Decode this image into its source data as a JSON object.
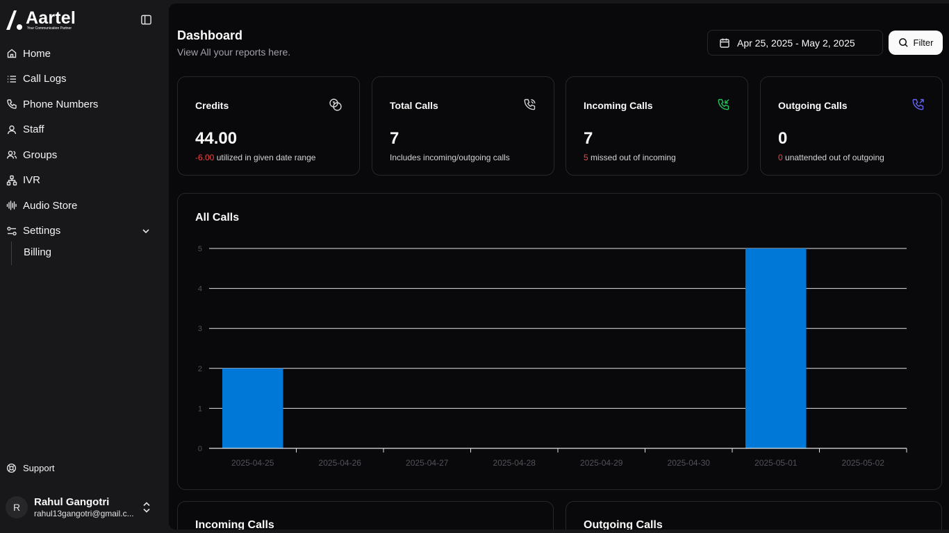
{
  "brand": {
    "name": "Aartel",
    "tagline": "Your Communication Partner"
  },
  "sidebar": {
    "items": [
      {
        "label": "Home",
        "icon": "home-icon"
      },
      {
        "label": "Call Logs",
        "icon": "list-icon"
      },
      {
        "label": "Phone Numbers",
        "icon": "phone-icon"
      },
      {
        "label": "Staff",
        "icon": "user-icon"
      },
      {
        "label": "Groups",
        "icon": "users-icon"
      },
      {
        "label": "IVR",
        "icon": "network-icon"
      },
      {
        "label": "Audio Store",
        "icon": "audio-wave-icon"
      },
      {
        "label": "Settings",
        "icon": "settings-sliders-icon"
      }
    ],
    "sub_items": [
      {
        "label": "Billing"
      }
    ],
    "support": "Support",
    "user": {
      "initial": "R",
      "name": "Rahul Gangotri",
      "email": "rahul13gangotri@gmail.c..."
    }
  },
  "header": {
    "title": "Dashboard",
    "subtitle": "View All your reports here.",
    "date_range": "Apr 25, 2025 - May 2, 2025",
    "filter_label": "Filter"
  },
  "cards": [
    {
      "title": "Credits",
      "value": "44.00",
      "note_highlight": "-6.00",
      "note": " utilized in given date range",
      "icon": "coins-icon",
      "icon_color": "#d4d4d8"
    },
    {
      "title": "Total Calls",
      "value": "7",
      "note_highlight": "",
      "note": "Includes incoming/outgoing calls",
      "icon": "phone-call-icon",
      "icon_color": "#d4d4d8"
    },
    {
      "title": "Incoming Calls",
      "value": "7",
      "note_highlight": "5",
      "note": " missed out of incoming",
      "icon": "phone-incoming-icon",
      "icon_color": "#22c55e"
    },
    {
      "title": "Outgoing Calls",
      "value": "0",
      "note_highlight": "0",
      "note": " unattended out of outgoing",
      "icon": "phone-outgoing-icon",
      "icon_color": "#6366f1"
    }
  ],
  "chart_title": "All Calls",
  "chart_data": {
    "type": "bar",
    "title": "All Calls",
    "categories": [
      "2025-04-25",
      "2025-04-26",
      "2025-04-27",
      "2025-04-28",
      "2025-04-29",
      "2025-04-30",
      "2025-05-01",
      "2025-05-02"
    ],
    "values": [
      2,
      0,
      0,
      0,
      0,
      0,
      5,
      0
    ],
    "ylim": [
      0,
      5
    ],
    "yticks": [
      0,
      1,
      2,
      3,
      4,
      5
    ],
    "grid": true,
    "bar_color": "#0078d7"
  },
  "bottom": {
    "incoming_title": "Incoming Calls",
    "outgoing_title": "Outgoing Calls"
  }
}
